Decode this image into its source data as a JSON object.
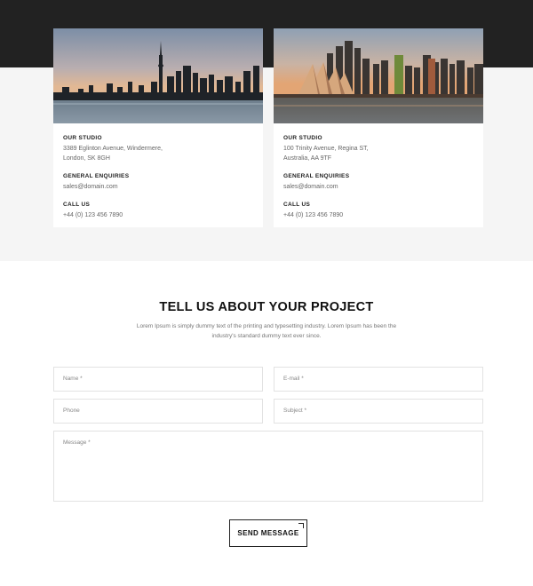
{
  "locations": [
    {
      "studio_label": "OUR STUDIO",
      "address_line1": "3389 Eglinton Avenue, Windermere,",
      "address_line2": "London, SK 8GH",
      "enquiries_label": "GENERAL ENQUIRIES",
      "email": "sales@domain.com",
      "call_label": "CALL US",
      "phone": "+44 (0) 123 456 7890"
    },
    {
      "studio_label": "OUR STUDIO",
      "address_line1": "100 Trinity Avenue, Regina ST,",
      "address_line2": "Australia, AA 9TF",
      "enquiries_label": "GENERAL ENQUIRIES",
      "email": "sales@domain.com",
      "call_label": "CALL US",
      "phone": "+44 (0) 123 456 7890"
    }
  ],
  "contact": {
    "heading": "TELL US ABOUT YOUR PROJECT",
    "subtext": "Lorem Ipsum is simply dummy text of the printing and typesetting industry. Lorem Ipsum has been the industry's standard dummy text ever since.",
    "fields": {
      "name": "Name *",
      "email": "E-mail *",
      "phone": "Phone",
      "subject": "Subject *",
      "message": "Message *"
    },
    "send_label": "SEND MESSAGE"
  }
}
